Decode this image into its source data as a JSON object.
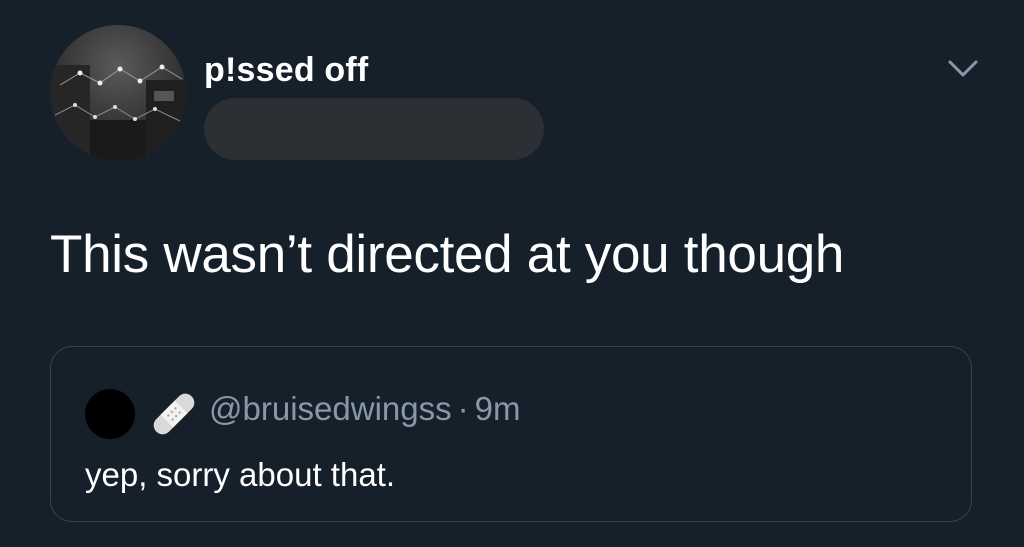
{
  "tweet": {
    "author": {
      "display_name": "p!ssed off",
      "handle_redacted": true,
      "avatar_icon": "avatar-photo-string-lights"
    },
    "menu_icon": "chevron-down-icon",
    "text": "This wasn’t directed at you though"
  },
  "quoted_tweet": {
    "avatar_icon": "avatar-black-circle",
    "badge_icon": "bandage-icon",
    "handle": "@bruisedwingss",
    "separator": "·",
    "time": "9m",
    "text": "yep, sorry about that."
  },
  "colors": {
    "background": "#15202b",
    "text_primary": "#ffffff",
    "text_secondary": "#8899a6",
    "border": "#38444d",
    "redaction": "#2c2f33"
  }
}
